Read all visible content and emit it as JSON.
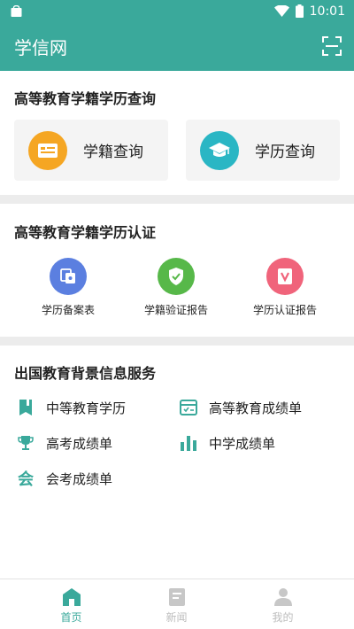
{
  "status_bar": {
    "time": "10:01"
  },
  "app_bar": {
    "title": "学信网"
  },
  "query_section": {
    "title": "高等教育学籍学历查询",
    "cards": [
      {
        "label": "学籍查询",
        "icon": "id-card-icon",
        "color": "#f5a623"
      },
      {
        "label": "学历查询",
        "icon": "graduation-cap-icon",
        "color": "#2ab6c4"
      }
    ]
  },
  "cert_section": {
    "title": "高等教育学籍学历认证",
    "items": [
      {
        "label": "学历备案表",
        "icon": "document-copy-icon",
        "color": "#5b7fe0"
      },
      {
        "label": "学籍验证报告",
        "icon": "shield-check-icon",
        "color": "#57b849"
      },
      {
        "label": "学历认证报告",
        "icon": "v-badge-icon",
        "color": "#f0647b"
      }
    ]
  },
  "abroad_section": {
    "title": "出国教育背景信息服务",
    "items": [
      {
        "label": "中等教育学历",
        "icon": "bookmark-icon"
      },
      {
        "label": "高等教育成绩单",
        "icon": "score-card-icon"
      },
      {
        "label": "高考成绩单",
        "icon": "trophy-icon"
      },
      {
        "label": "中学成绩单",
        "icon": "bar-chart-icon"
      },
      {
        "label": "会考成绩单",
        "icon": "hui-char-icon",
        "glyph": "会"
      }
    ],
    "icon_color": "#3aa99b"
  },
  "tab_bar": {
    "tabs": [
      {
        "label": "首页",
        "icon": "home-icon",
        "active": true
      },
      {
        "label": "新闻",
        "icon": "news-icon",
        "active": false
      },
      {
        "label": "我的",
        "icon": "person-icon",
        "active": false
      }
    ],
    "active_color": "#3aa99b",
    "inactive_color": "#bdbdbd"
  }
}
